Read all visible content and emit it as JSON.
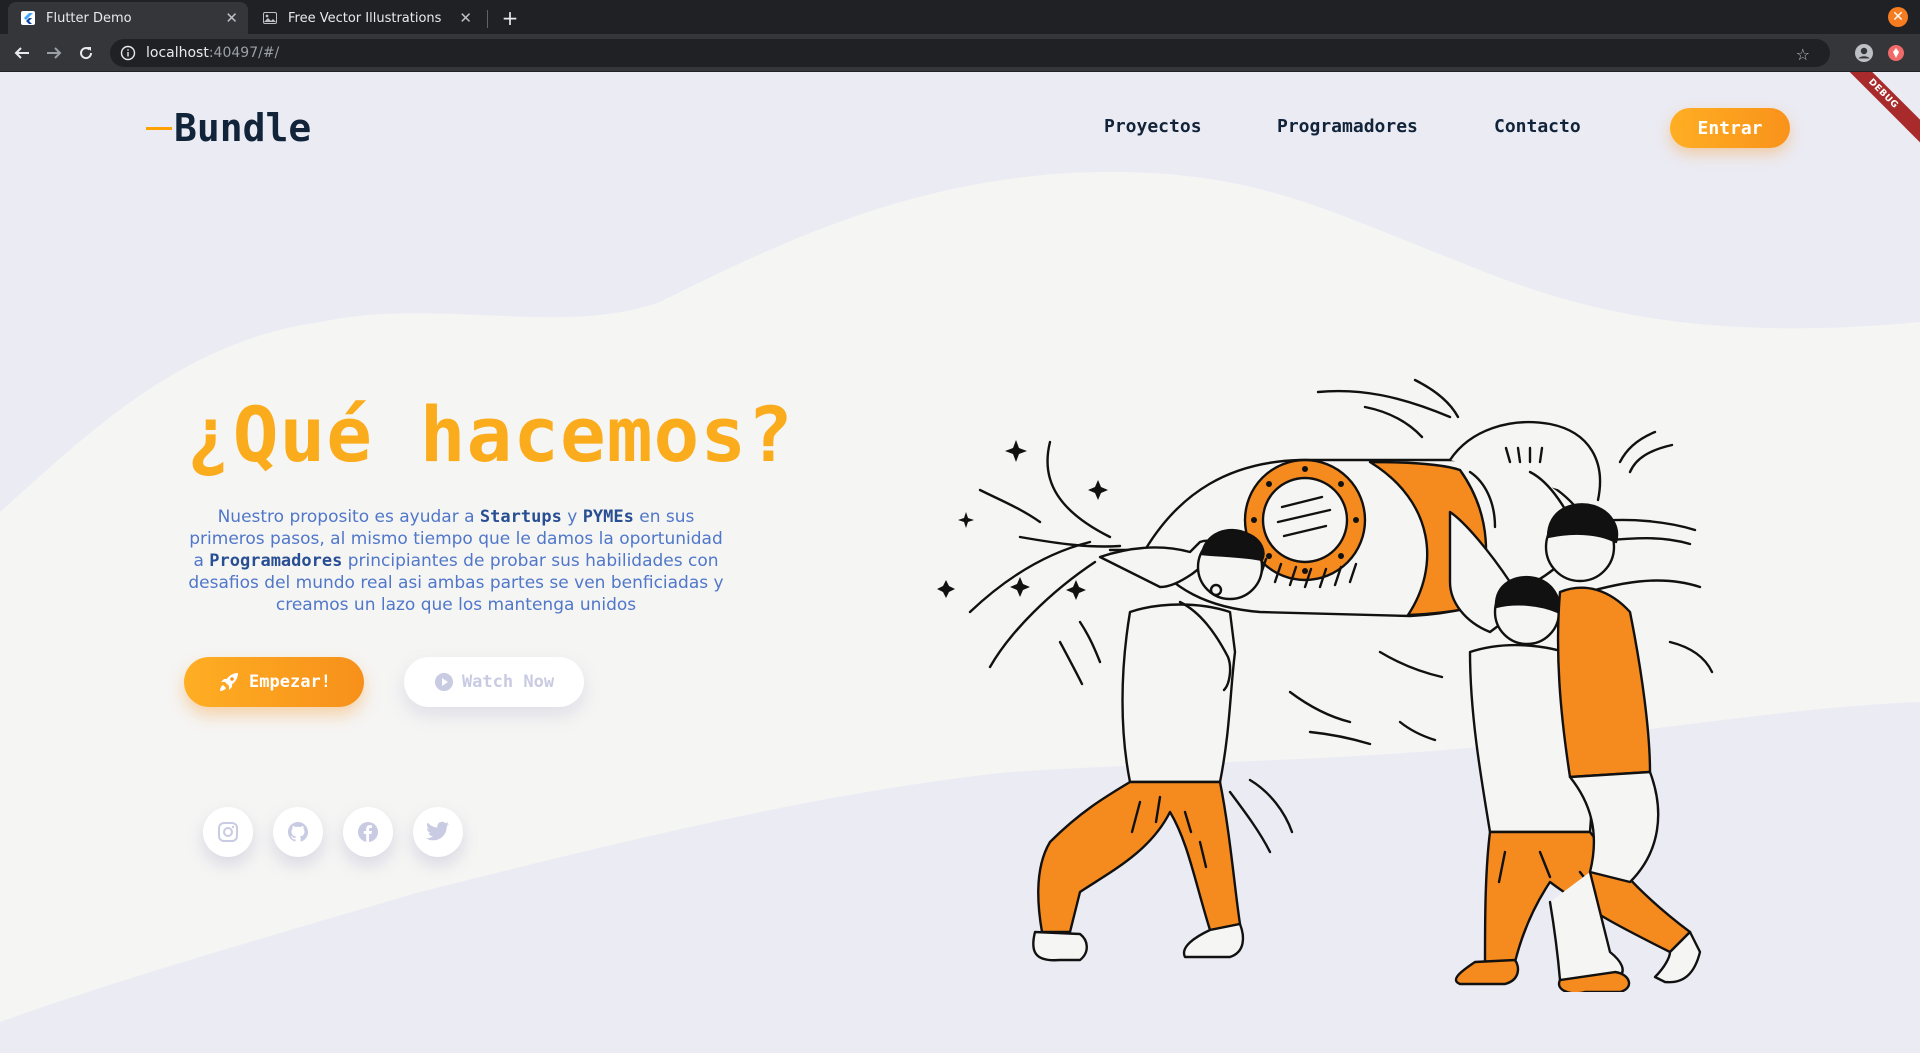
{
  "browser": {
    "tabs": [
      {
        "title": "Flutter Demo",
        "active": true
      },
      {
        "title": "Free Vector Illustrations",
        "active": false
      }
    ],
    "url_host": "localhost",
    "url_rest": ":40497/#/"
  },
  "debug_badge": "DEBUG",
  "header": {
    "logo": "Bundle",
    "nav": [
      "Proyectos",
      "Programadores",
      "Contacto"
    ],
    "cta": "Entrar"
  },
  "hero": {
    "title": "¿Qué hacemos?",
    "desc": {
      "p1": "Nuestro proposito es ayudar a ",
      "b1": "Startups",
      "p2": " y ",
      "b2": "PYMEs",
      "p3": "  en sus primeros pasos, al mismo tiempo que le damos la oportunidad a ",
      "b3": "Programadores",
      "p4": "  principiantes de probar sus habilidades con desafios del mundo real asi ambas partes se ven benficiadas y creamos un lazo que los mantenga unidos"
    },
    "primary_button": "Empezar!",
    "secondary_button": "Watch Now"
  },
  "social_icons": [
    "instagram-icon",
    "github-icon",
    "facebook-icon",
    "twitter-icon"
  ],
  "colors": {
    "accent_orange": "#fbac1c",
    "button_orange": "#f9921a",
    "navy": "#12243a",
    "text_blue": "#5077c9",
    "illustration_orange": "#f58a1f",
    "background": "#ebebf3",
    "wave": "#f5f5f4"
  }
}
